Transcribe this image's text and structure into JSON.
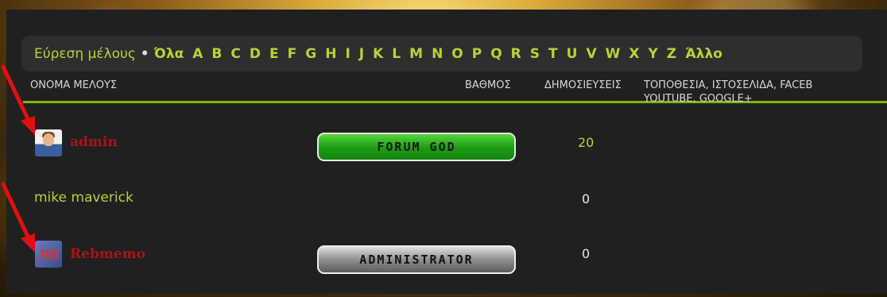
{
  "letterbar": {
    "label": "Εύρεση μέλους",
    "letters": [
      "Όλα",
      "A",
      "B",
      "C",
      "D",
      "E",
      "F",
      "G",
      "H",
      "I",
      "J",
      "K",
      "L",
      "M",
      "N",
      "O",
      "P",
      "Q",
      "R",
      "S",
      "T",
      "U",
      "V",
      "W",
      "X",
      "Y",
      "Z",
      "Άλλο"
    ]
  },
  "columns": {
    "name": "ΟΝΟΜΑ ΜΕΛΟΥΣ",
    "rank": "ΒΑΘΜΟΣ",
    "posts": "ΔΗΜΟΣΙΕΥΣΕΙΣ",
    "location": "ΤΟΠΟΘΕΣΙΑ, ΙΣΤΟΣΕΛΙΔΑ, FACEB",
    "social": "YOUTUBE, GOOGLE+"
  },
  "members": [
    {
      "name": "admin",
      "rank": "FORUM GOD",
      "posts": "20"
    },
    {
      "name": "mike maverick",
      "rank": "",
      "posts": "0"
    },
    {
      "name": "Rebmemo",
      "rank": "ADMINISTRATOR",
      "posts": "0"
    }
  ],
  "colors": {
    "accent_green": "#b9d33a",
    "admin_red": "#a8141b",
    "header_line": "#7fb80e",
    "annotation_arrow": "#e01010"
  }
}
